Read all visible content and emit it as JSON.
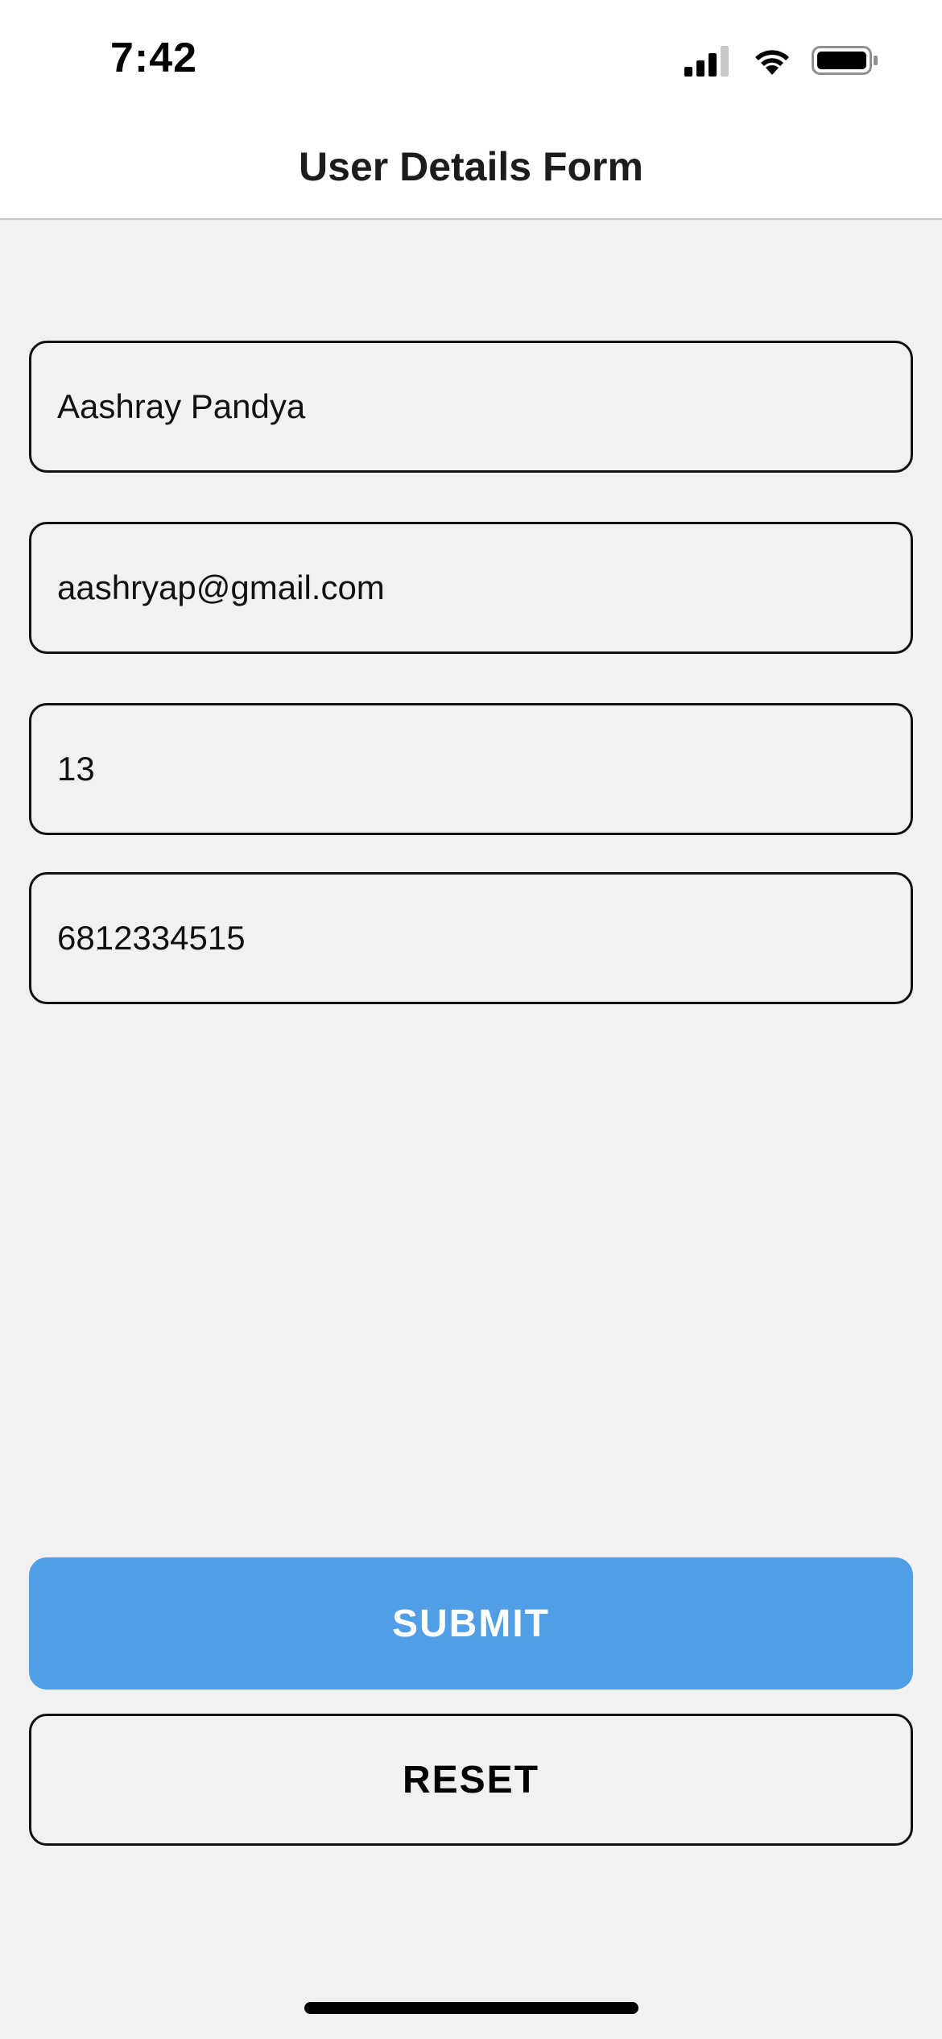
{
  "status_bar": {
    "time": "7:42",
    "icons": [
      "cellular-signal-icon",
      "wifi-icon",
      "battery-icon"
    ]
  },
  "header": {
    "title": "User Details Form"
  },
  "form": {
    "fields": [
      {
        "name": "full-name",
        "value": "Aashray Pandya"
      },
      {
        "name": "email",
        "value": "aashryap@gmail.com"
      },
      {
        "name": "age",
        "value": "13"
      },
      {
        "name": "phone",
        "value": "6812334515"
      }
    ]
  },
  "actions": {
    "submit_label": "SUBMIT",
    "reset_label": "RESET"
  },
  "colors": {
    "accent": "#4f9ee6",
    "background": "#f1f1f1",
    "border": "#111111"
  }
}
